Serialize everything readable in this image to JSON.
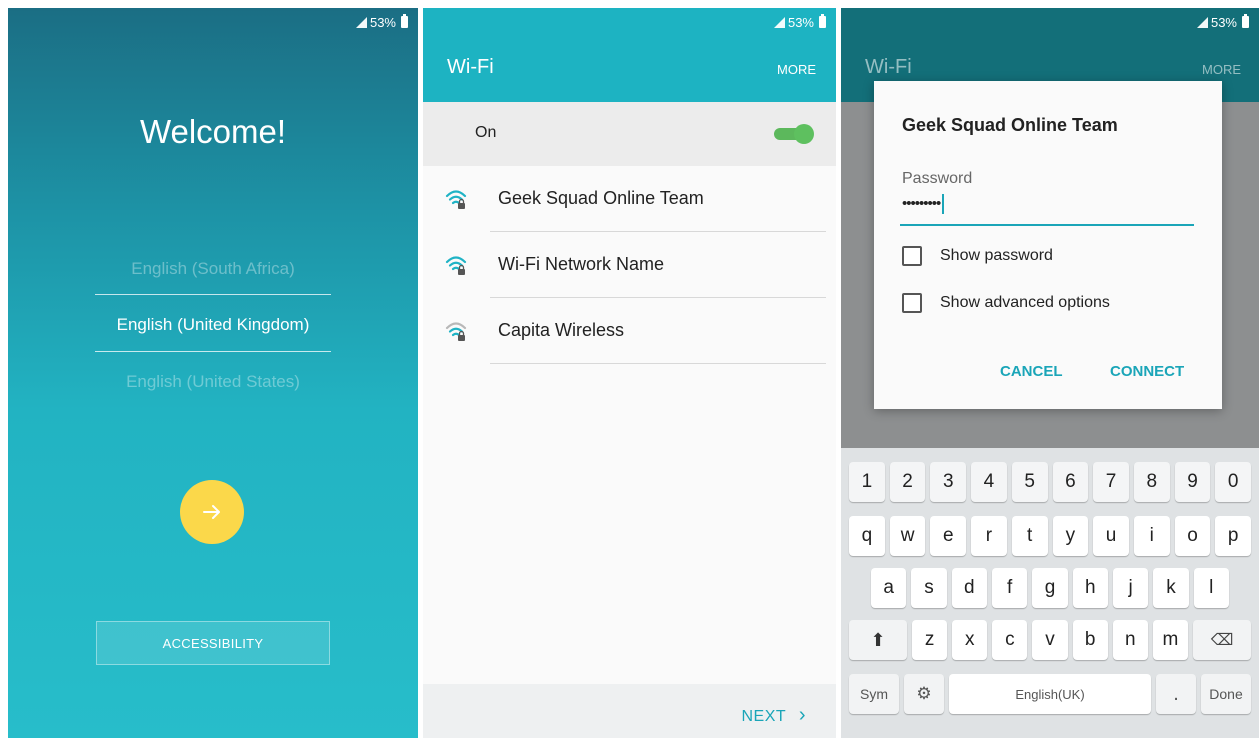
{
  "status": {
    "battery": "53%"
  },
  "welcome": {
    "title": "Welcome!",
    "languages": [
      "English (South Africa)",
      "English (United Kingdom)",
      "English (United States)"
    ],
    "selected_index": 1,
    "accessibility_label": "ACCESSIBILITY",
    "next_icon": "arrow-right-icon"
  },
  "wifi": {
    "title": "Wi-Fi",
    "more_label": "MORE",
    "toggle_label": "On",
    "toggle_on": true,
    "networks": [
      {
        "name": "Geek Squad Online Team",
        "icon": "wifi-lock-icon"
      },
      {
        "name": "Wi-Fi Network Name",
        "icon": "wifi-lock-icon"
      },
      {
        "name": "Capita Wireless",
        "icon": "wifi-lock-icon"
      }
    ],
    "next_label": "NEXT",
    "next_chevron": "›"
  },
  "dialog": {
    "appbar_title": "Wi-Fi",
    "appbar_more": "MORE",
    "title": "Geek Squad Online Team",
    "password_label": "Password",
    "password_value": "•••••••••",
    "show_password": "Show password",
    "show_advanced": "Show advanced options",
    "cancel": "CANCEL",
    "connect": "CONNECT"
  },
  "keyboard": {
    "numbers": [
      "1",
      "2",
      "3",
      "4",
      "5",
      "6",
      "7",
      "8",
      "9",
      "0"
    ],
    "row1": [
      "q",
      "w",
      "e",
      "r",
      "t",
      "y",
      "u",
      "i",
      "o",
      "p"
    ],
    "row2": [
      "a",
      "s",
      "d",
      "f",
      "g",
      "h",
      "j",
      "k",
      "l"
    ],
    "row3": [
      "z",
      "x",
      "c",
      "v",
      "b",
      "n",
      "m"
    ],
    "shift": "⬆",
    "backspace": "⌫",
    "sym": "Sym",
    "settings_icon": "⚙",
    "space_label": "English(UK)",
    "period": ".",
    "done": "Done"
  },
  "colors": {
    "accent": "#1aa5b8",
    "fab": "#fbd84a",
    "toggle": "#5cb85c"
  }
}
